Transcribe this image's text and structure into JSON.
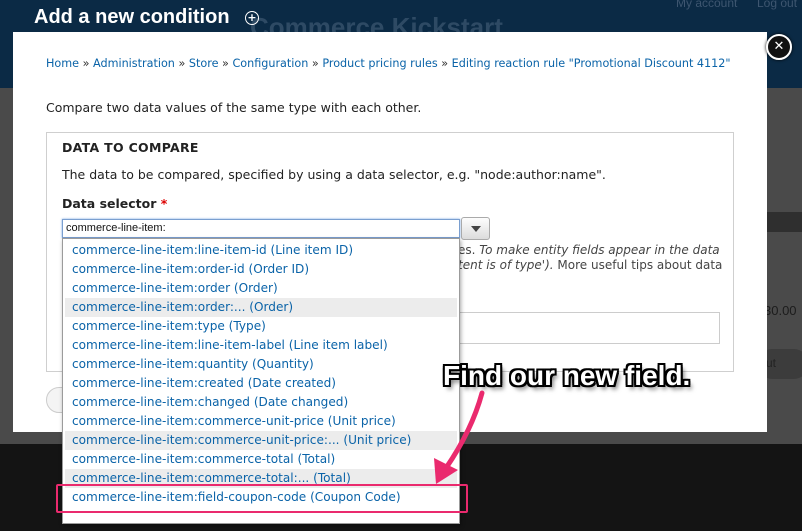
{
  "background": {
    "site_name": "Commerce Kickstart",
    "my_account": "My account",
    "log_out": "Log out",
    "price_fragment": "30.00",
    "button_fragment": "ut"
  },
  "modal": {
    "title": "Add a new condition",
    "close_glyph": "✕",
    "breadcrumb": [
      {
        "label": "Home"
      },
      {
        "label": "Administration"
      },
      {
        "label": "Store"
      },
      {
        "label": "Configuration"
      },
      {
        "label": "Product pricing rules"
      },
      {
        "label": "Editing reaction rule \"Promotional Discount 4112\""
      }
    ],
    "breadcrumb_separator": "»",
    "intro": "Compare two data values of the same type with each other.",
    "fieldset": {
      "legend": "DATA TO COMPARE",
      "description": "The data to be compared, specified by using a data selector, e.g. \"node:author:name\".",
      "selector_label": "Data selector",
      "required_marker": "*",
      "selector_value": "commerce-line-item:",
      "help_line1_a": "es. ",
      "help_line1_b": "To make entity fields appear in the data",
      "help_line2_a": "tent is of type').",
      "help_line2_b": " More useful tips about data"
    }
  },
  "autocomplete": {
    "items": [
      {
        "label": "commerce-line-item:line-item-id (Line item ID)",
        "alt": false
      },
      {
        "label": "commerce-line-item:order-id (Order ID)",
        "alt": false
      },
      {
        "label": "commerce-line-item:order (Order)",
        "alt": false
      },
      {
        "label": "commerce-line-item:order:... (Order)",
        "alt": true
      },
      {
        "label": "commerce-line-item:type (Type)",
        "alt": false
      },
      {
        "label": "commerce-line-item:line-item-label (Line item label)",
        "alt": false
      },
      {
        "label": "commerce-line-item:quantity (Quantity)",
        "alt": false
      },
      {
        "label": "commerce-line-item:created (Date created)",
        "alt": false
      },
      {
        "label": "commerce-line-item:changed (Date changed)",
        "alt": false
      },
      {
        "label": "commerce-line-item:commerce-unit-price (Unit price)",
        "alt": false
      },
      {
        "label": "commerce-line-item:commerce-unit-price:... (Unit price)",
        "alt": true
      },
      {
        "label": "commerce-line-item:commerce-total (Total)",
        "alt": false
      },
      {
        "label": "commerce-line-item:commerce-total:... (Total)",
        "alt": true
      },
      {
        "label": "commerce-line-item:field-coupon-code (Coupon Code)",
        "alt": false
      }
    ]
  },
  "annotation": {
    "callout": "Find our new field.",
    "color": "#ea2a6e"
  },
  "colors": {
    "link": "#0a63a8",
    "header_bg": "#0b2a45"
  }
}
